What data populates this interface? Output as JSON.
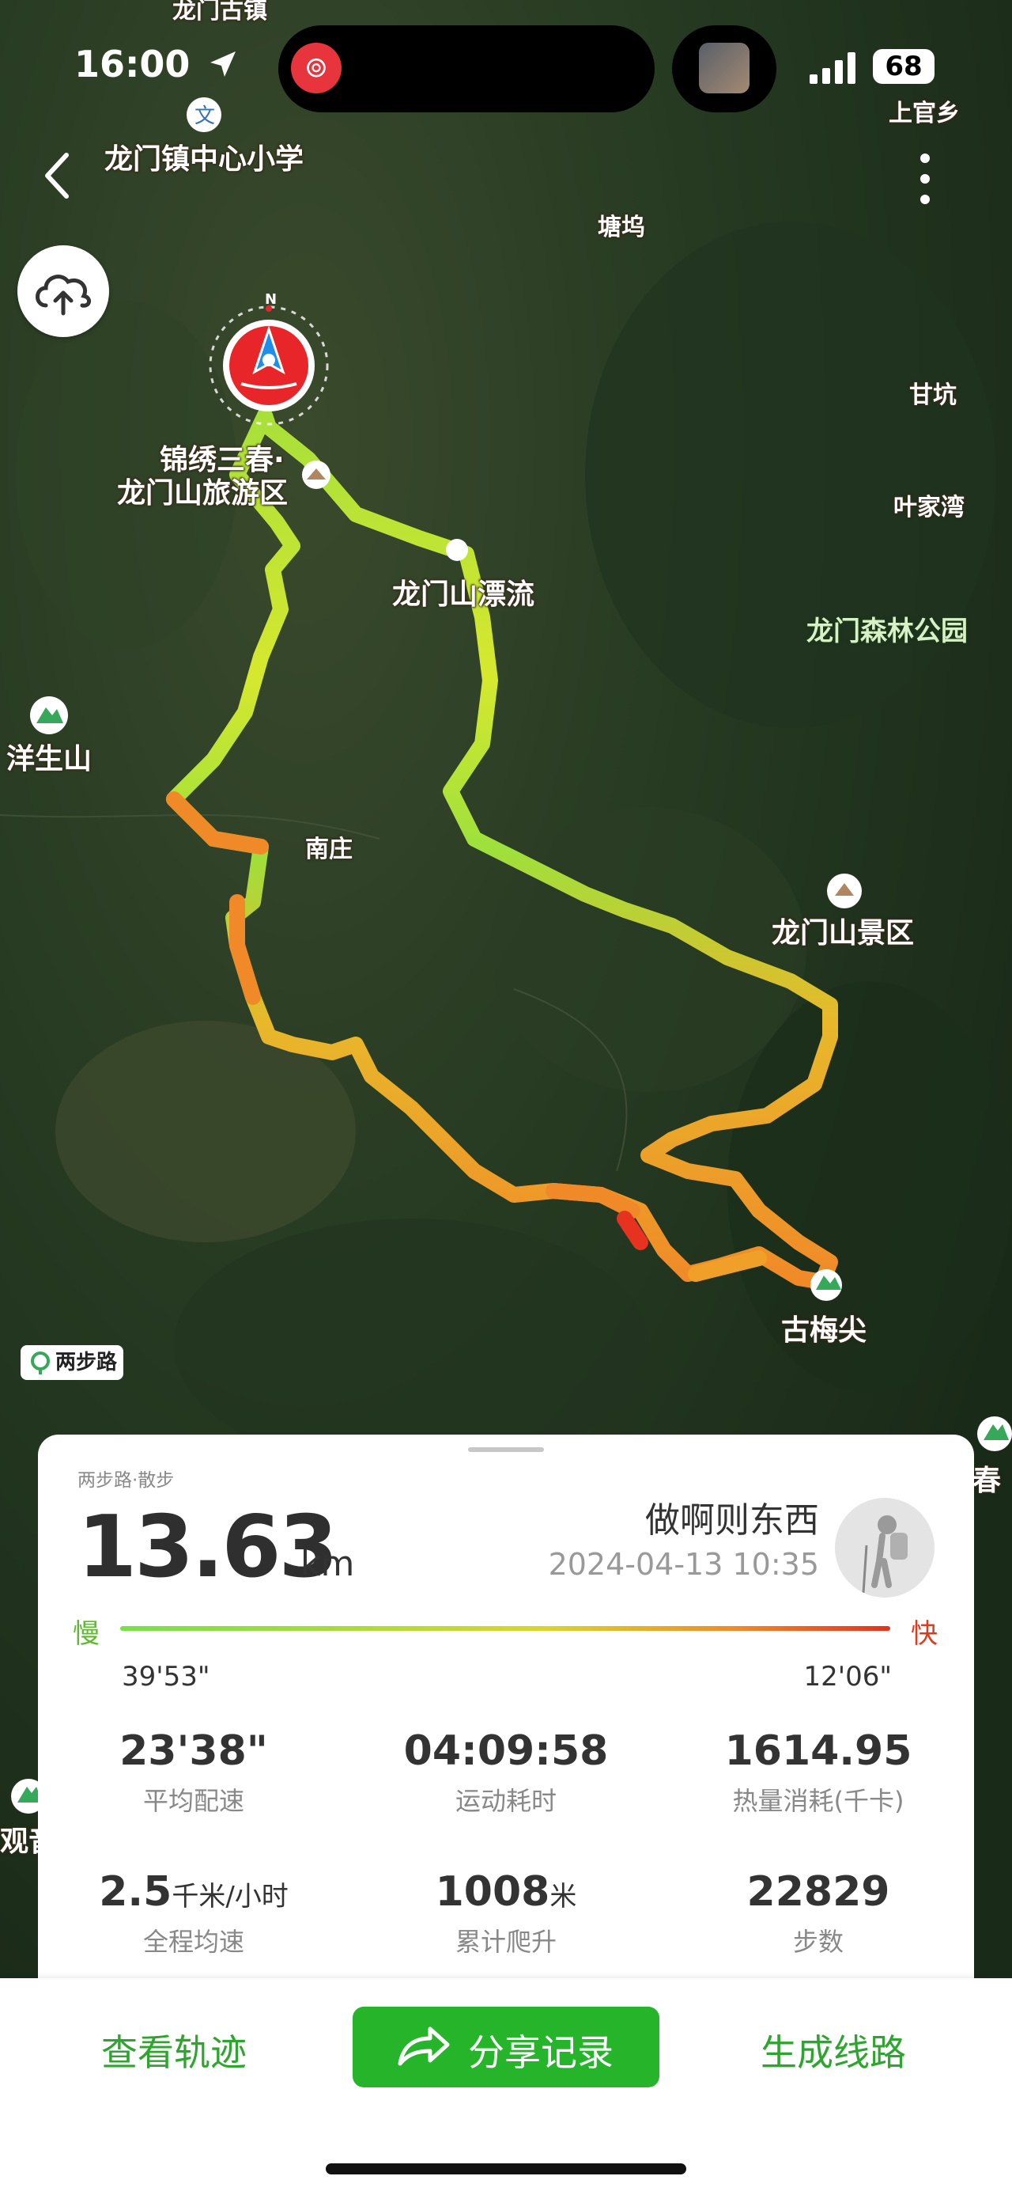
{
  "status_bar": {
    "time": "16:00",
    "battery": "68"
  },
  "map": {
    "labels": {
      "longmen_village_top": "龙门古镇",
      "shangguan": "上官乡",
      "school": "龙门镇中心小学",
      "tangwu": "塘坞",
      "ganhang": "甘坑",
      "yejiawan": "叶家湾",
      "scenic_area_top_1": "锦绣三春·",
      "scenic_area_top_2": "龙门山旅游区",
      "rafting": "龙门山漂流",
      "forest_park": "龙门森林公园",
      "yangsheng": "洋生山",
      "nanzhuang": "南庄",
      "longmen_scenic": "龙门山景区",
      "gumeijian": "古梅尖",
      "right_edge_1": "春",
      "left_edge_1": "观音"
    },
    "compass_label": "N",
    "brand": "两步路"
  },
  "card": {
    "source": "两步路·散步",
    "distance": "13.63",
    "distance_unit": "km",
    "username": "做啊则东西",
    "datetime": "2024-04-13 10:35",
    "pace_slow_label": "慢",
    "pace_fast_label": "快",
    "pace_slowest": "39'53\"",
    "pace_fastest": "12'06\"",
    "stats": [
      {
        "value": "23'38\"",
        "unit": "",
        "label": "平均配速"
      },
      {
        "value": "04:09:58",
        "unit": "",
        "label": "运动耗时"
      },
      {
        "value": "1614.95",
        "unit": "",
        "label": "热量消耗(千卡)"
      },
      {
        "value": "2.5",
        "unit": "千米/小时",
        "label": "全程均速"
      },
      {
        "value": "1008",
        "unit": "米",
        "label": "累计爬升"
      },
      {
        "value": "22829",
        "unit": "",
        "label": "步数"
      }
    ]
  },
  "actions": {
    "view_track": "查看轨迹",
    "share": "分享记录",
    "generate_route": "生成线路"
  },
  "colors": {
    "accent": "#26b52a",
    "slow": "#5abb2b",
    "fast": "#e03a1e"
  }
}
